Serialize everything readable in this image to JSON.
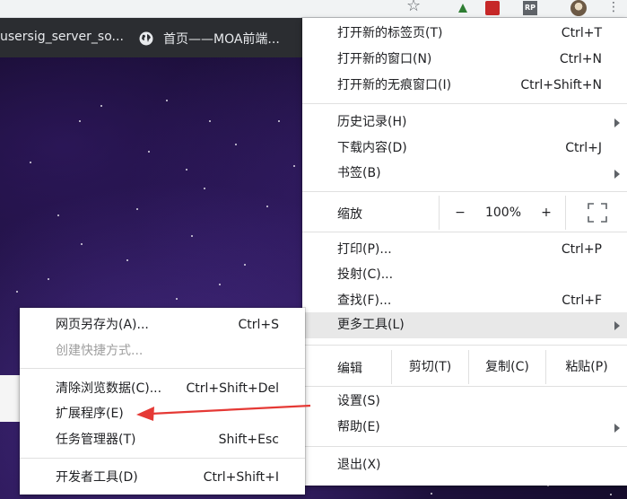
{
  "colors": {
    "accent_arrow": "#e53935",
    "menu_bg": "#ffffff",
    "hover_bg": "#e8e8e8",
    "disabled_text": "#9e9e9e"
  },
  "toolbar": {
    "icons": [
      "star-icon",
      "extension-icon",
      "extension-icon",
      "extension-icon",
      "avatar",
      "kebab-menu-icon"
    ],
    "rp_label": "RP",
    "kebab": "⋮",
    "star": "☆"
  },
  "bookmarks": [
    {
      "label": "usersig_server_so..."
    },
    {
      "label": "首页——MOA前端..."
    }
  ],
  "main_menu": {
    "new_tab": {
      "label": "打开新的标签页(T)",
      "shortcut": "Ctrl+T"
    },
    "new_window": {
      "label": "打开新的窗口(N)",
      "shortcut": "Ctrl+N"
    },
    "new_incognito": {
      "label": "打开新的无痕窗口(I)",
      "shortcut": "Ctrl+Shift+N"
    },
    "history": {
      "label": "历史记录(H)"
    },
    "downloads": {
      "label": "下载内容(D)",
      "shortcut": "Ctrl+J"
    },
    "bookmarks": {
      "label": "书签(B)"
    },
    "zoom": {
      "label": "缩放",
      "minus": "−",
      "value": "100%",
      "plus": "+"
    },
    "print": {
      "label": "打印(P)...",
      "shortcut": "Ctrl+P"
    },
    "cast": {
      "label": "投射(C)..."
    },
    "find": {
      "label": "查找(F)...",
      "shortcut": "Ctrl+F"
    },
    "more_tools": {
      "label": "更多工具(L)"
    },
    "edit": {
      "label": "编辑",
      "cut": "剪切(T)",
      "copy": "复制(C)",
      "paste": "粘贴(P)"
    },
    "settings": {
      "label": "设置(S)"
    },
    "help": {
      "label": "帮助(E)"
    },
    "exit": {
      "label": "退出(X)"
    }
  },
  "sub_menu": {
    "save_page": {
      "label": "网页另存为(A)...",
      "shortcut": "Ctrl+S"
    },
    "create_shortcut": {
      "label": "创建快捷方式..."
    },
    "clear_data": {
      "label": "清除浏览数据(C)...",
      "shortcut": "Ctrl+Shift+Del"
    },
    "extensions": {
      "label": "扩展程序(E)"
    },
    "task_manager": {
      "label": "任务管理器(T)",
      "shortcut": "Shift+Esc"
    },
    "dev_tools": {
      "label": "开发者工具(D)",
      "shortcut": "Ctrl+Shift+I"
    }
  }
}
